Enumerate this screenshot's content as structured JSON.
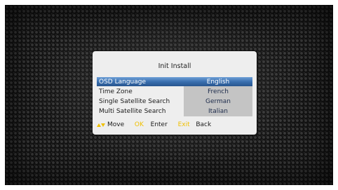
{
  "dialog": {
    "title": "Init Install",
    "rows": [
      {
        "label": "OSD Language",
        "value": "English",
        "selected": true
      },
      {
        "label": "Time Zone",
        "value": "French",
        "selected": false
      },
      {
        "label": "Single Satellite Search",
        "value": "German",
        "selected": false
      },
      {
        "label": "Multi Satellite Search",
        "value": "Italian",
        "selected": false
      }
    ]
  },
  "footer": {
    "move_label": "Move",
    "ok_key": "OK",
    "enter_label": "Enter",
    "exit_key": "Exit",
    "back_label": "Back"
  },
  "colors": {
    "highlight": "#3a6faf",
    "key_hint": "#f0c000",
    "dialog_bg": "#eeeeee",
    "options_bg": "#c4c4c4"
  }
}
